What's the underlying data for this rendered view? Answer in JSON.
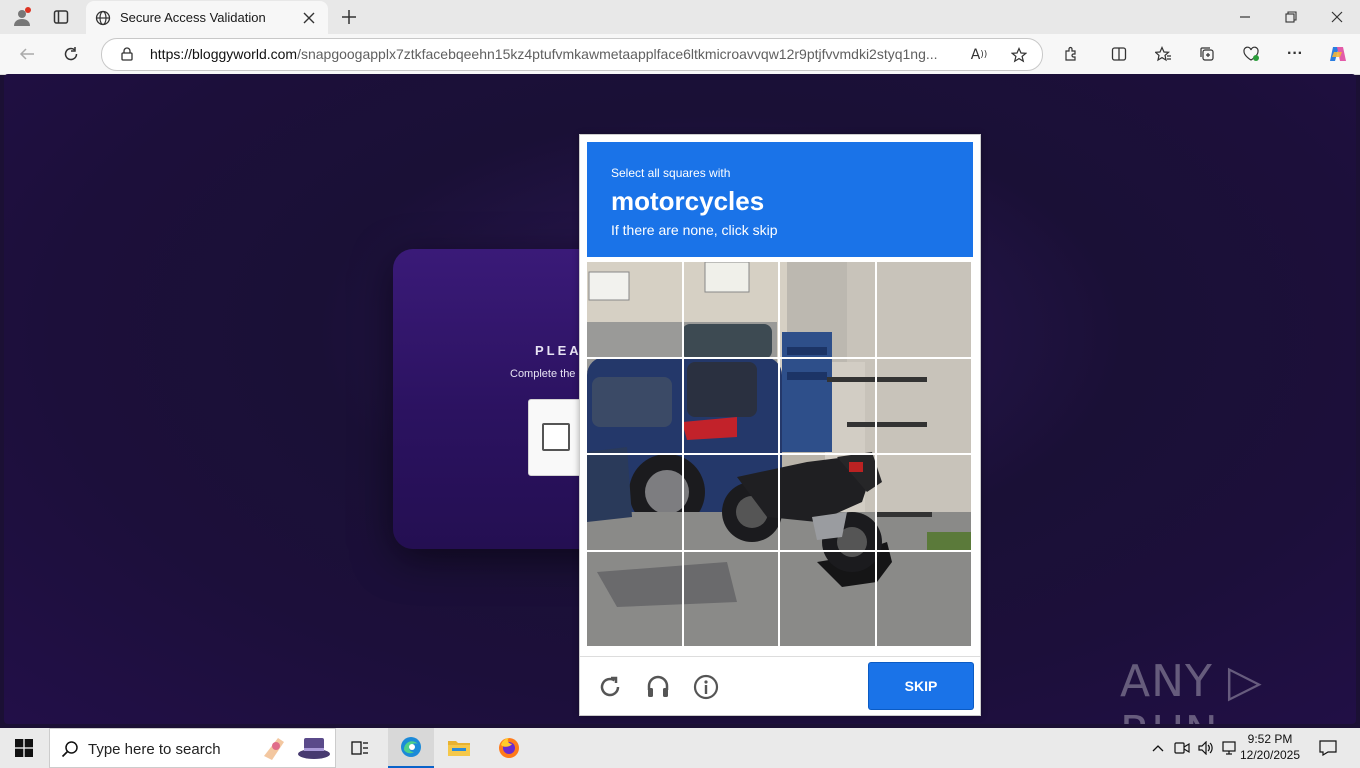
{
  "browser": {
    "tab_title": "Secure Access Validation",
    "url_domain": "https://bloggyworld.com",
    "url_path": "/snapgoogapplx7ztkfacebqeehn15kz4ptufvmkawmetaapplface6ltkmicroavvqw12r9ptjfvvmdki2styq1ng..."
  },
  "page": {
    "card_title": "PLEAS",
    "card_sub": "Complete the"
  },
  "captcha": {
    "instruction": "Select all squares with",
    "target": "motorcycles",
    "hint": "If there are none, click skip",
    "skip_label": "SKIP",
    "tiles": [
      "1",
      "2",
      "3",
      "4",
      "5",
      "6",
      "7",
      "8",
      "9",
      "10",
      "11",
      "12",
      "13",
      "14",
      "15",
      "16"
    ]
  },
  "watermark": "ANY ▷ RUN",
  "taskbar": {
    "search_placeholder": "Type here to search",
    "time": "9:52 PM",
    "date": "12/20/2025"
  },
  "colors": {
    "accent": "#1a73e8",
    "background": "#1b1034"
  }
}
